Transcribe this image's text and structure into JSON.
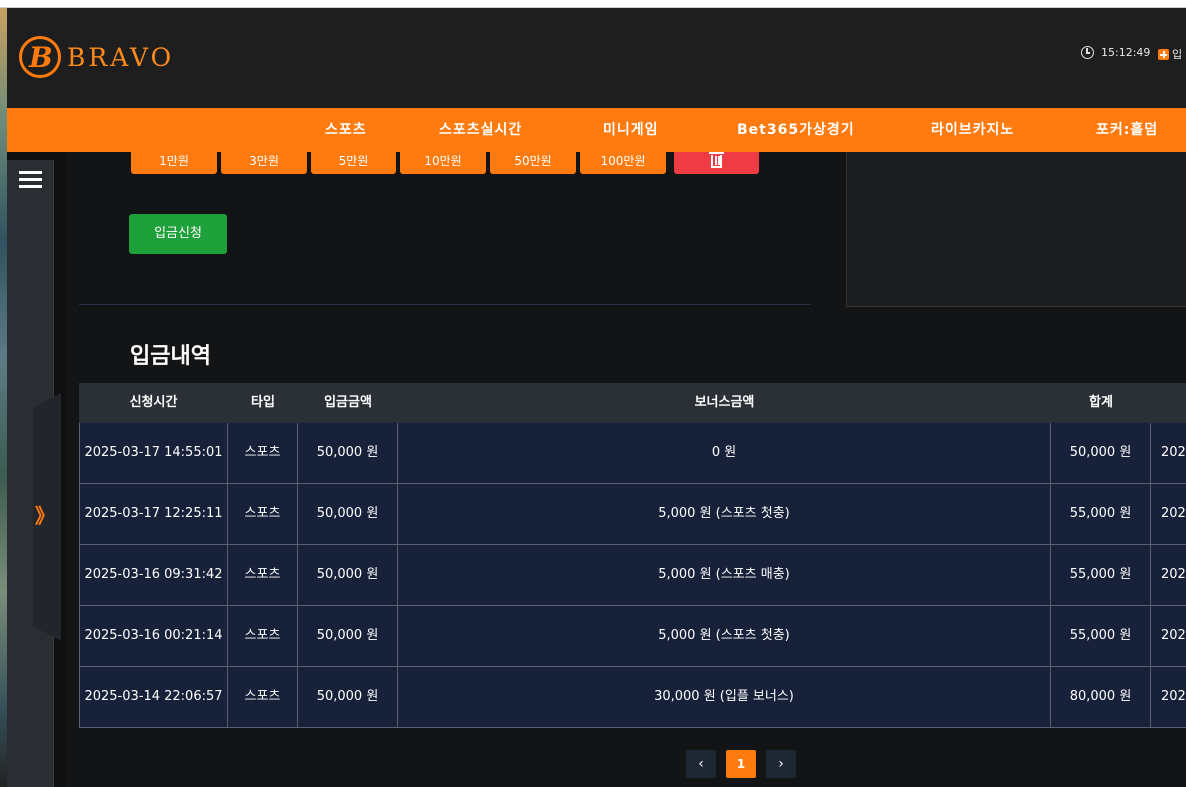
{
  "header": {
    "logo_text": "BRAVO",
    "logo_letter": "B",
    "time": "15:12:49",
    "login_label": "입"
  },
  "nav": {
    "items": [
      {
        "label": "스포츠"
      },
      {
        "label": "스포츠실시간"
      },
      {
        "label": "미니게임"
      },
      {
        "label": "Bet365가상경기"
      },
      {
        "label": "라이브카지노"
      },
      {
        "label": "포커:홀덤"
      }
    ]
  },
  "amount_buttons": [
    {
      "label": "1만원"
    },
    {
      "label": "3만원"
    },
    {
      "label": "5만원"
    },
    {
      "label": "10만원"
    },
    {
      "label": "50만원"
    },
    {
      "label": "100만원"
    }
  ],
  "deposit_button": "입금신청",
  "history": {
    "title": "입금내역",
    "columns": [
      "신청시간",
      "타입",
      "입금금액",
      "보너스금액",
      "합계"
    ],
    "rows": [
      {
        "time": "2025-03-17 14:55:01",
        "type": "스포츠",
        "amount": "50,000 원",
        "bonus": "0 원",
        "total": "50,000 원",
        "extra": "202"
      },
      {
        "time": "2025-03-17 12:25:11",
        "type": "스포츠",
        "amount": "50,000 원",
        "bonus": "5,000 원 (스포츠 첫충)",
        "total": "55,000 원",
        "extra": "202"
      },
      {
        "time": "2025-03-16 09:31:42",
        "type": "스포츠",
        "amount": "50,000 원",
        "bonus": "5,000 원 (스포츠 매충)",
        "total": "55,000 원",
        "extra": "202"
      },
      {
        "time": "2025-03-16 00:21:14",
        "type": "스포츠",
        "amount": "50,000 원",
        "bonus": "5,000 원 (스포츠 첫충)",
        "total": "55,000 원",
        "extra": "202"
      },
      {
        "time": "2025-03-14 22:06:57",
        "type": "스포츠",
        "amount": "50,000 원",
        "bonus": "30,000 원 (입플 보너스)",
        "total": "80,000 원",
        "extra": "202"
      }
    ]
  },
  "pagination": {
    "prev": "‹",
    "current": "1",
    "next": "›"
  },
  "sidebar": {
    "expand_glyph": "》"
  },
  "colors": {
    "accent": "#ff7b0f",
    "deposit_green": "#1ea03a",
    "trash_red": "#ef3c44"
  }
}
